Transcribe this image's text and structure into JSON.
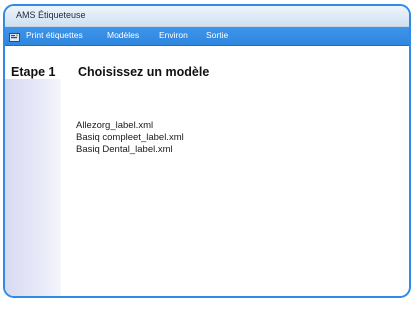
{
  "window": {
    "title": "AMS Étiqueteuse"
  },
  "menu": {
    "icon": "app-label-icon",
    "items": [
      {
        "label": "Print étiquettes"
      },
      {
        "label": "Modèles"
      },
      {
        "label": "Environ"
      },
      {
        "label": "Sortie"
      }
    ]
  },
  "step": {
    "number": "Etape 1",
    "title": "Choisissez un modèle"
  },
  "models": [
    {
      "name": "Allezorg_label.xml"
    },
    {
      "name": "Basiq compleet_label.xml"
    },
    {
      "name": "Basiq Dental_label.xml"
    }
  ],
  "colors": {
    "window_border": "#2f8be6",
    "menubar": "#3a90e6",
    "menu_text": "#ffffff",
    "side_panel": "#dcdcf2"
  }
}
